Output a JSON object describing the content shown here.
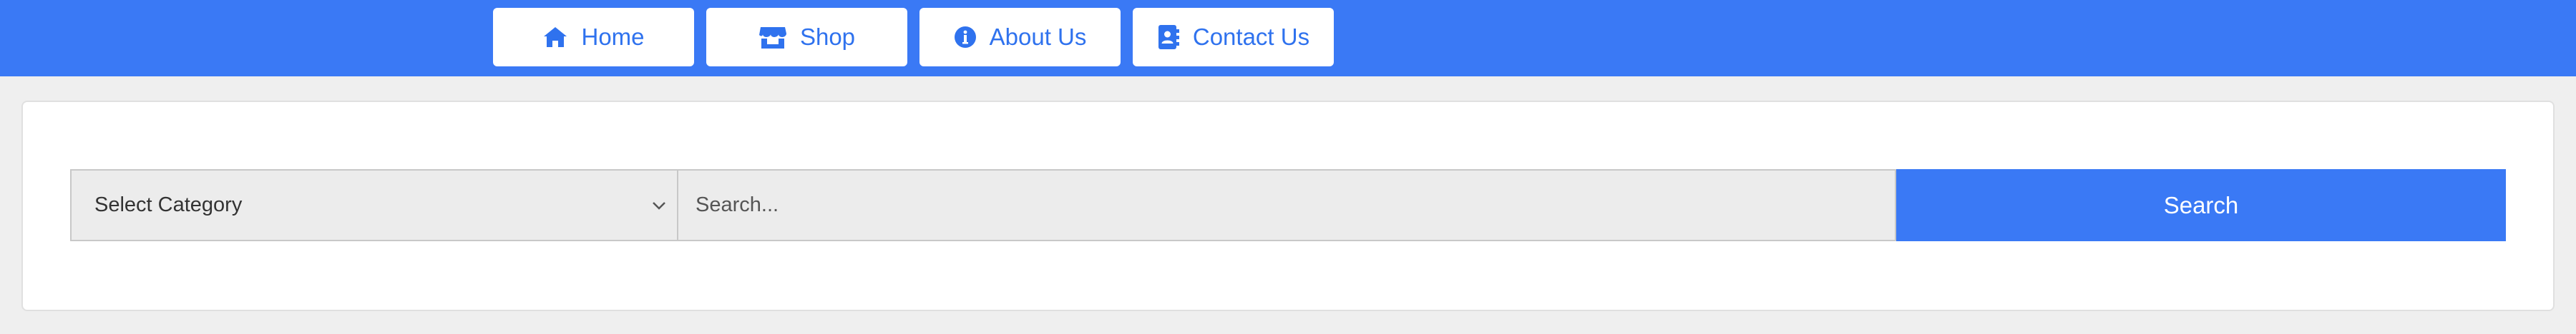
{
  "nav": {
    "items": [
      {
        "label": "Home",
        "icon": "home-icon"
      },
      {
        "label": "Shop",
        "icon": "store-icon"
      },
      {
        "label": "About Us",
        "icon": "info-icon"
      },
      {
        "label": "Contact Us",
        "icon": "contact-book-icon"
      }
    ]
  },
  "search": {
    "category_label": "Select Category",
    "placeholder": "Search...",
    "button_label": "Search"
  },
  "colors": {
    "brand_blue": "#3a79f5",
    "page_bg": "#efefef",
    "input_bg": "#ececec"
  }
}
